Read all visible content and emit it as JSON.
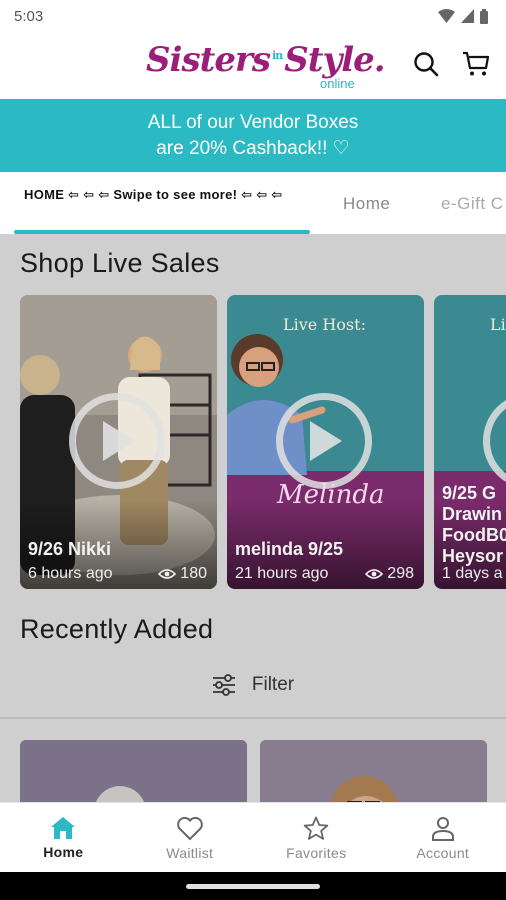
{
  "status_bar": {
    "time": "5:03"
  },
  "header": {
    "logo": {
      "part1": "Sisters",
      "part2": "in",
      "part3": "Style.",
      "sub": "online"
    }
  },
  "promo": {
    "line1": "ALL of our Vendor Boxes",
    "line2": "are 20% Cashback!! ♡"
  },
  "tabs": {
    "active_label": "HOME ⇦ ⇦ ⇦ Swipe to see more! ⇦ ⇦ ⇦",
    "items": [
      "Home",
      "e-Gift C"
    ]
  },
  "live_sales": {
    "title": "Shop Live Sales",
    "cards": [
      {
        "title": "9/26 Nikki",
        "time": "6 hours ago",
        "views": "180"
      },
      {
        "title": "melinda 9/25",
        "time": "21 hours ago",
        "views": "298",
        "overlay_heading": "Live Host:",
        "overlay_name": "Melinda"
      },
      {
        "overlay_heading": "Li",
        "text_lines": [
          "9/25 G",
          "Drawin",
          "FoodB0",
          "Heysor"
        ],
        "time": "1 days a"
      }
    ]
  },
  "recent": {
    "title": "Recently Added",
    "filter_label": "Filter"
  },
  "bottom_nav": {
    "items": [
      {
        "label": "Home",
        "icon": "home-icon",
        "active": true
      },
      {
        "label": "Waitlist",
        "icon": "heart-icon"
      },
      {
        "label": "Favorites",
        "icon": "star-icon"
      },
      {
        "label": "Account",
        "icon": "person-icon"
      }
    ]
  },
  "colors": {
    "brand_purple": "#9b1f7a",
    "brand_teal": "#2bbac4"
  }
}
